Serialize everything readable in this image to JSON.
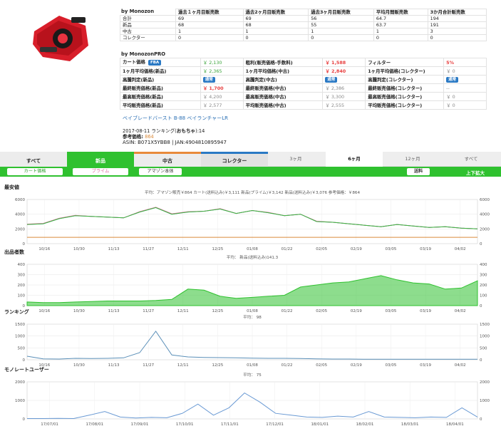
{
  "product": {
    "image_icon": "launcher-toy-icon",
    "name": "ベイブレードバースト B-88 ベイランチャーLR",
    "release": "2017-08-11 ランキング(",
    "category": "おもちゃ",
    "rank_suffix": "):14",
    "ref_label": "参考価格:",
    "ref_value": "864",
    "asin": "ASIN: B071X5YBB8 | JAN:4904810895947"
  },
  "sales": {
    "title": "by Monozon",
    "headers": [
      "過去１ヶ月目販売数",
      "過去2ヶ月目販売数",
      "過去3ヶ月目販売数",
      "平均月間販売数",
      "3か月合計販売数"
    ],
    "rows": [
      {
        "label": "合計",
        "v": [
          "69",
          "69",
          "56",
          "64.7",
          "194"
        ]
      },
      {
        "label": "新品",
        "v": [
          "68",
          "68",
          "55",
          "63.7",
          "191"
        ]
      },
      {
        "label": "中古",
        "v": [
          "1",
          "1",
          "1",
          "1",
          "3"
        ]
      },
      {
        "label": "コレクター",
        "v": [
          "0",
          "0",
          "0",
          "0",
          "0"
        ]
      }
    ]
  },
  "pro": {
    "title": "by MonozonPRO",
    "rows": [
      [
        {
          "t": "カート価格",
          "badge": "FBA"
        },
        {
          "t": "￥ 2,130",
          "c": "green"
        },
        {
          "t": "粗利(販売価格-手数料)"
        },
        {
          "t": "￥ 1,588",
          "c": "red"
        },
        {
          "t": "フィルター"
        },
        {
          "t": "5%",
          "c": "red"
        }
      ],
      [
        {
          "t": "1ヶ月平均価格(新品)"
        },
        {
          "t": "￥ 2,365",
          "c": "green"
        },
        {
          "t": "1ヶ月平均価格(中古)"
        },
        {
          "t": "￥ 2,840",
          "c": "red"
        },
        {
          "t": "1ヶ月平均価格(コレクター)"
        },
        {
          "t": "￥ 0",
          "c": "gray"
        }
      ],
      [
        {
          "t": "高騰判定(新品)"
        },
        {
          "badge": "通常"
        },
        {
          "t": "高騰判定(中古)"
        },
        {
          "badge": "通常"
        },
        {
          "t": "高騰判定(コレクター)"
        },
        {
          "badge": "通常"
        }
      ],
      [
        {
          "t": "最終販売価格(新品)"
        },
        {
          "t": "￥ 1,700",
          "c": "red"
        },
        {
          "t": "最終販売価格(中古)"
        },
        {
          "t": "￥ 2,386",
          "c": "gray"
        },
        {
          "t": "最終販売価格(コレクター)"
        },
        {
          "t": "--",
          "c": "gray"
        }
      ],
      [
        {
          "t": "最高販売価格(新品)"
        },
        {
          "t": "￥ 4,200",
          "c": "gray"
        },
        {
          "t": "最高販売価格(中古)"
        },
        {
          "t": "￥ 3,300",
          "c": "gray"
        },
        {
          "t": "最高販売価格(コレクター)"
        },
        {
          "t": "￥ 0",
          "c": "gray"
        }
      ],
      [
        {
          "t": "平均販売価格(新品)"
        },
        {
          "t": "￥ 2,577",
          "c": "gray"
        },
        {
          "t": "平均販売価格(中古)"
        },
        {
          "t": "￥ 2,555",
          "c": "gray"
        },
        {
          "t": "平均販売価格(コレクター)"
        },
        {
          "t": "￥ 0",
          "c": "gray"
        }
      ]
    ]
  },
  "tabs": [
    {
      "label": "すべて",
      "bg": "#ececec"
    },
    {
      "label": "新品",
      "bg": "#2fc12f"
    },
    {
      "label": "中古",
      "bg": "#ececec"
    },
    {
      "label": "コレクター",
      "bg": "#e2e2e2"
    }
  ],
  "ranges": [
    "3ヶ月",
    "6ヶ月",
    "12ヶ月",
    "すべて"
  ],
  "filters": {
    "cart": "カート価格",
    "prime": "プライム",
    "amazon": "アマゾン本体",
    "shipping": "送料",
    "zoom": "上下拡大"
  },
  "chart_data": [
    {
      "type": "line",
      "title": "最安値",
      "subtitle": "平均：アマゾン販売￥864",
      "legend": [
        "カート(送料込み)￥3,111",
        "新品(プライム)￥3,142",
        "新品(送料込み)￥3,076",
        "参考価格：￥864"
      ],
      "x_ticks": [
        "10/16",
        "10/30",
        "11/13",
        "11/27",
        "12/11",
        "12/25",
        "01/08",
        "01/22",
        "02/05",
        "02/19",
        "03/05",
        "03/19",
        "04/02"
      ],
      "ylim": [
        0,
        6000
      ],
      "y_ticks": [
        0,
        2000,
        4000,
        6000
      ],
      "series": [
        {
          "name": "カート(送料込み)",
          "color": "#4a86d8",
          "values": [
            2600,
            2700,
            3400,
            3800,
            3700,
            3600,
            3500,
            4300,
            4900,
            4000,
            4300,
            4400,
            4700,
            4100,
            4500,
            4200,
            3800,
            4000,
            3000,
            2900,
            2700,
            2500,
            2300,
            2600,
            2400,
            2200,
            2300,
            2100,
            2000
          ]
        },
        {
          "name": "新品(プライム)",
          "color": "#e06aa0",
          "values": [
            2650,
            2750,
            3450,
            3850,
            3700,
            3600,
            3500,
            4350,
            4950,
            4050,
            4350,
            4400,
            4750,
            4100,
            4500,
            4250,
            3800,
            4000,
            3050,
            2900,
            2700,
            2500,
            2300,
            2600,
            2400,
            2200,
            2300,
            2100,
            2000
          ]
        },
        {
          "name": "新品(送料込み)",
          "color": "#3cb83c",
          "values": [
            2600,
            2700,
            3400,
            3800,
            3700,
            3600,
            3500,
            4300,
            4900,
            4000,
            4300,
            4400,
            4700,
            4100,
            4500,
            4200,
            3800,
            4000,
            3000,
            2900,
            2700,
            2500,
            2300,
            2600,
            2400,
            2200,
            2300,
            2100,
            2000
          ]
        },
        {
          "name": "参考価格",
          "color": "#d98a3a",
          "values": [
            864,
            864,
            864,
            864,
            864,
            864,
            864,
            864,
            864,
            864,
            864,
            864,
            864,
            864,
            864,
            864,
            864,
            864,
            864,
            864,
            864,
            864,
            864,
            864,
            864,
            864,
            864,
            864,
            864
          ]
        }
      ]
    },
    {
      "type": "area",
      "title": "出品者数",
      "subtitle": "平均：",
      "legend": [
        "新品(送料込み)141.3"
      ],
      "x_ticks": [
        "10/16",
        "10/30",
        "11/13",
        "11/27",
        "12/11",
        "12/25",
        "01/08",
        "01/22",
        "02/05",
        "02/19",
        "03/05",
        "03/19",
        "04/02"
      ],
      "ylim": [
        0,
        400
      ],
      "y_ticks": [
        0,
        100,
        200,
        300,
        400
      ],
      "series": [
        {
          "name": "新品(送料込み)",
          "color": "#2fc12f",
          "values": [
            35,
            30,
            30,
            35,
            40,
            45,
            45,
            45,
            50,
            60,
            160,
            150,
            90,
            70,
            80,
            90,
            100,
            180,
            200,
            220,
            230,
            260,
            290,
            250,
            220,
            210,
            160,
            170,
            240
          ]
        }
      ]
    },
    {
      "type": "line",
      "title": "ランキング",
      "subtitle": "平均：",
      "legend": [
        "98"
      ],
      "x_ticks": [
        "10/16",
        "10/30",
        "11/13",
        "11/27",
        "12/11",
        "12/25",
        "01/08",
        "01/22",
        "02/05",
        "02/19",
        "03/05",
        "03/19",
        "04/02"
      ],
      "ylim": [
        0,
        1500
      ],
      "y_ticks": [
        0,
        500,
        1000,
        1500
      ],
      "series": [
        {
          "name": "ランキング",
          "color": "#5a8fb8",
          "values": [
            150,
            40,
            30,
            60,
            50,
            60,
            80,
            300,
            1200,
            200,
            120,
            100,
            90,
            80,
            70,
            60,
            60,
            50,
            40,
            30,
            30,
            20,
            20,
            20,
            20,
            20,
            20,
            20,
            20
          ]
        }
      ]
    },
    {
      "type": "line",
      "title": "モノレートユーザー",
      "subtitle": "平均：",
      "legend": [
        "75"
      ],
      "x_ticks": [
        "17/07/01",
        "17/08/01",
        "17/09/01",
        "17/10/01",
        "17/11/01",
        "17/12/01",
        "18/01/01",
        "18/02/01",
        "18/03/01",
        "18/04/01"
      ],
      "ylim": [
        0,
        2000
      ],
      "y_ticks": [
        0,
        1000,
        2000
      ],
      "series": [
        {
          "name": "モノレートユーザー",
          "color": "#6a9ad4",
          "values": [
            20,
            20,
            30,
            20,
            200,
            400,
            100,
            50,
            80,
            60,
            300,
            800,
            200,
            600,
            1400,
            900,
            300,
            200,
            100,
            80,
            150,
            100,
            400,
            100,
            80,
            60,
            100,
            80,
            600,
            100
          ]
        }
      ]
    }
  ]
}
